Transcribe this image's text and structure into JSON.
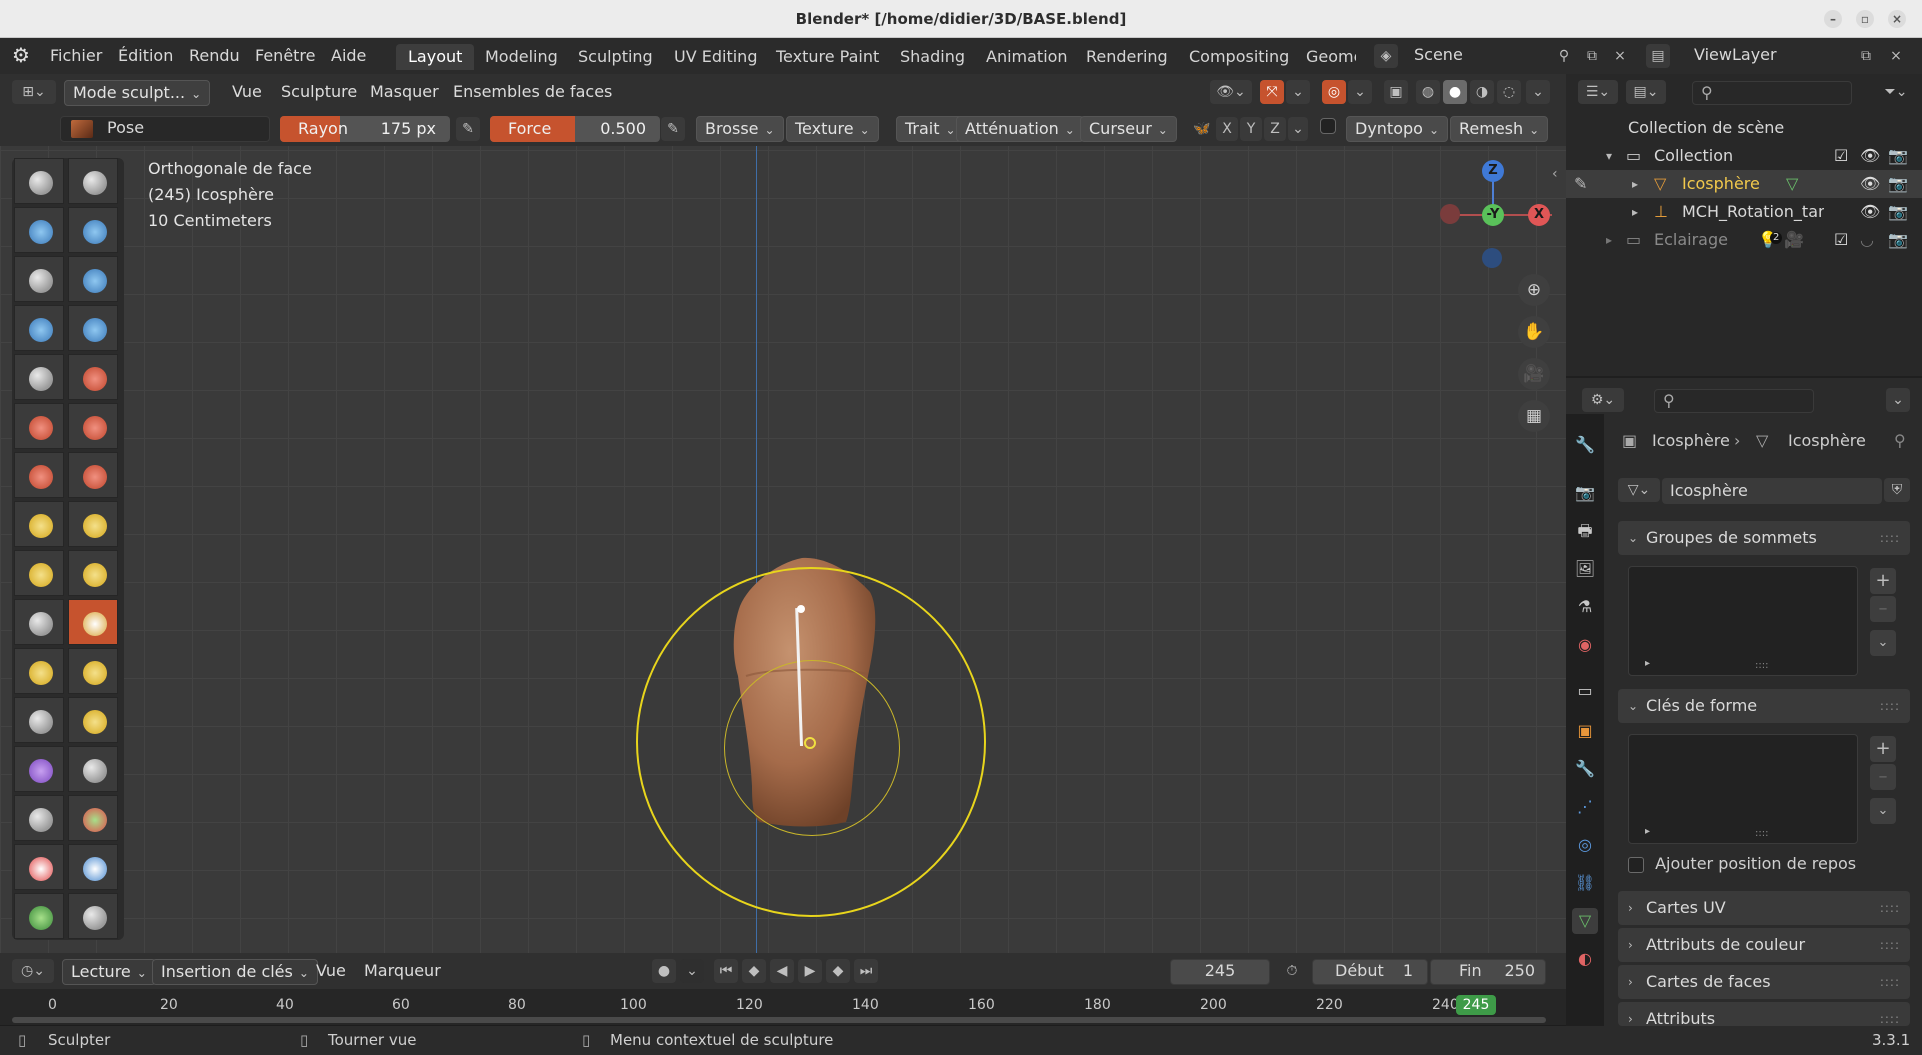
{
  "window": {
    "title": "Blender* [/home/didier/3D/BASE.blend]"
  },
  "menubar": {
    "items": [
      "Fichier",
      "Édition",
      "Rendu",
      "Fenêtre",
      "Aide"
    ]
  },
  "workspaces": {
    "tabs": [
      "Layout",
      "Modeling",
      "Sculpting",
      "UV Editing",
      "Texture Paint",
      "Shading",
      "Animation",
      "Rendering",
      "Compositing",
      "Geome"
    ],
    "active": "Layout"
  },
  "scene": {
    "name": "Scene"
  },
  "viewlayer": {
    "name": "ViewLayer"
  },
  "header": {
    "mode": "Mode sculpt...",
    "menus": [
      "Vue",
      "Sculpture",
      "Masquer",
      "Ensembles de faces"
    ]
  },
  "tool_settings": {
    "brush_name": "Pose",
    "radius_label": "Rayon",
    "radius_value": "175 px",
    "radius_fill": 0.35,
    "strength_label": "Force",
    "strength_value": "0.500",
    "strength_fill": 0.5,
    "dropdowns": [
      "Brosse",
      "Texture",
      "Trait",
      "Atténuation",
      "Curseur"
    ],
    "axes": [
      "X",
      "Y",
      "Z"
    ],
    "dyntopo": "Dyntopo",
    "remesh": "Remesh"
  },
  "viewport_overlay": {
    "view_name": "Orthogonale de face",
    "object_info": "(245) Icosphère",
    "scale": "10 Centimeters"
  },
  "gizmo": {
    "z": "Z",
    "y": "-Y",
    "x": "X"
  },
  "outliner": {
    "root": "Collection de scène",
    "rows": [
      {
        "label": "Collection"
      },
      {
        "label": "Icosphère"
      },
      {
        "label": "MCH_Rotation_targ"
      },
      {
        "label": "Eclairage",
        "badge": "2"
      }
    ]
  },
  "properties": {
    "breadcrumb_object": "Icosphère",
    "breadcrumb_data": "Icosphère",
    "datablock": "Icosphère",
    "panels": {
      "vertex_groups": "Groupes de sommets",
      "shape_keys": "Clés de forme",
      "rest_position": "Ajouter position de repos",
      "uv_maps": "Cartes UV",
      "color_attributes": "Attributs de couleur",
      "face_maps": "Cartes de faces",
      "attributes": "Attributs"
    }
  },
  "timeline": {
    "playback": "Lecture",
    "keying": "Insertion de clés",
    "view": "Vue",
    "marker": "Marqueur",
    "current_frame": "245",
    "start_label": "Début",
    "start": "1",
    "end_label": "Fin",
    "end": "250",
    "ticks": [
      "0",
      "20",
      "40",
      "60",
      "80",
      "100",
      "120",
      "140",
      "160",
      "180",
      "200",
      "220",
      "240"
    ],
    "playhead": "245"
  },
  "statusbar": {
    "left": "Sculpter",
    "middle": "Tourner vue",
    "right": "Menu contextuel de sculpture",
    "version": "3.3.1"
  }
}
